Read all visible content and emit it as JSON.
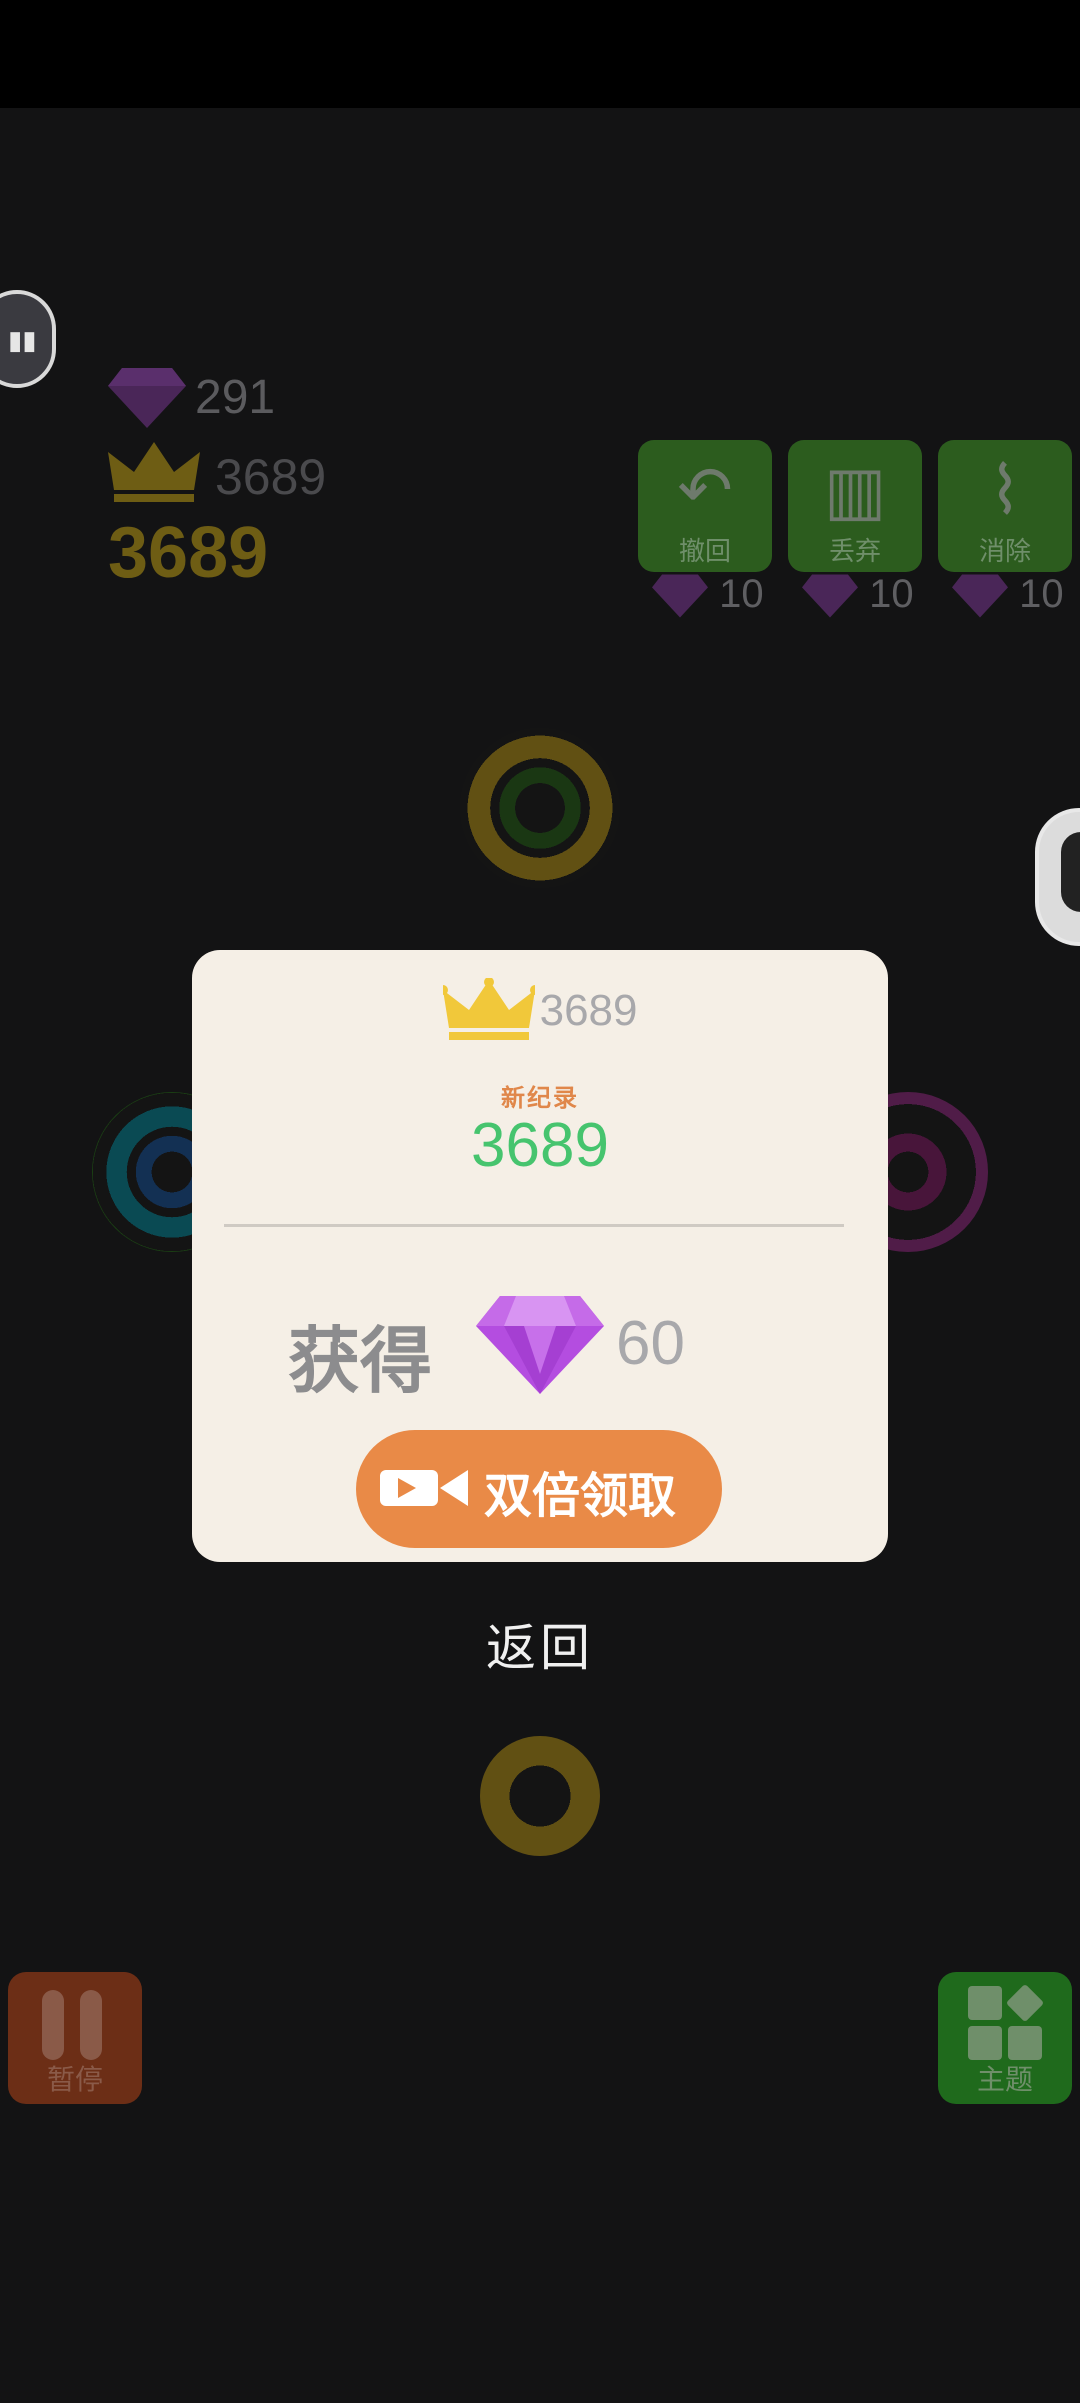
{
  "stats": {
    "gems": "291",
    "best": "3689",
    "score": "3689"
  },
  "tools": [
    {
      "label": "撤回",
      "cost": "10",
      "icon": "undo-icon"
    },
    {
      "label": "丢弃",
      "cost": "10",
      "icon": "trash-icon"
    },
    {
      "label": "消除",
      "cost": "10",
      "icon": "broom-icon"
    }
  ],
  "bottom": {
    "pause_label": "暂停",
    "theme_label": "主题"
  },
  "dialog": {
    "best": "3689",
    "new_record_label": "新纪录",
    "score": "3689",
    "earn_label": "获得",
    "earn_amount": "60",
    "double_button": "双倍领取"
  },
  "back_label": "返回",
  "colors": {
    "accent_orange": "#e98a47",
    "score_green": "#46c46e",
    "gem_purple": "#b44de0",
    "crown_gold": "#f1c83a"
  }
}
